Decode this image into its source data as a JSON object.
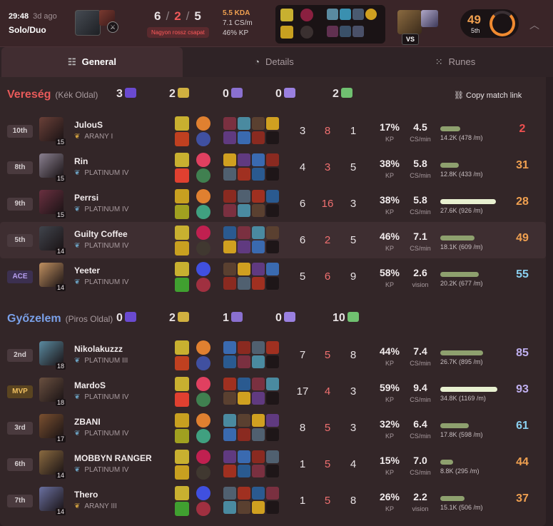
{
  "header": {
    "time": "29:48",
    "ago": "3d ago",
    "queue": "Solo/Duo",
    "kills": "6",
    "deaths": "2",
    "assists": "5",
    "badge": "Nagyon rossz csapat",
    "kda": "5.5 KDA",
    "cs": "7.1 CS/m",
    "kp": "46% KP",
    "vs": "VS",
    "score": "49",
    "place": "5th"
  },
  "tabs": [
    "General",
    "Details",
    "Runes"
  ],
  "copy_link": "Copy match link",
  "teams": [
    {
      "result": "Vereség",
      "side": "(Kék Oldal)",
      "color": "#e85a5a",
      "objectives": [
        "3",
        "2",
        "0",
        "0",
        "2"
      ],
      "players": [
        {
          "rank": "10th",
          "name": "JulouS",
          "tier": "ARANY I",
          "level": "15",
          "k": "3",
          "d": "8",
          "a": "1",
          "kp": "17%",
          "cs": "4.5",
          "cs_label": "CS/min",
          "dmg": "14.2K (478 /m)",
          "dmg_frac": 0.35,
          "score": "2",
          "score_color": "#f05050"
        },
        {
          "rank": "8th",
          "name": "Rin",
          "tier": "PLATINUM IV",
          "level": "15",
          "k": "4",
          "d": "3",
          "a": "5",
          "kp": "38%",
          "cs": "5.8",
          "cs_label": "CS/min",
          "dmg": "12.8K (433 /m)",
          "dmg_frac": 0.32,
          "score": "31",
          "score_color": "#f0a050"
        },
        {
          "rank": "9th",
          "name": "Perrsi",
          "tier": "PLATINUM IV",
          "level": "15",
          "k": "6",
          "d": "16",
          "a": "3",
          "kp": "38%",
          "cs": "5.8",
          "cs_label": "CS/min",
          "dmg": "27.6K (926 /m)",
          "dmg_frac": 0.98,
          "score": "28",
          "score_color": "#f0a050"
        },
        {
          "rank": "5th",
          "name": "Guilty Coffee",
          "tier": "PLATINUM IV",
          "level": "14",
          "k": "6",
          "d": "2",
          "a": "5",
          "kp": "46%",
          "cs": "7.1",
          "cs_label": "CS/min",
          "dmg": "18.1K (609 /m)",
          "dmg_frac": 0.6,
          "score": "49",
          "score_color": "#f0a050"
        },
        {
          "rank": "ACE",
          "name": "Yeeter",
          "tier": "PLATINUM IV",
          "level": "14",
          "k": "5",
          "d": "6",
          "a": "9",
          "kp": "58%",
          "cs": "2.6",
          "cs_label": "vision",
          "dmg": "20.2K (677 /m)",
          "dmg_frac": 0.68,
          "score": "55",
          "score_color": "#8ad0f0"
        }
      ]
    },
    {
      "result": "Győzelem",
      "side": "(Piros Oldal)",
      "color": "#7aa0e8",
      "objectives": [
        "0",
        "2",
        "1",
        "0",
        "10"
      ],
      "players": [
        {
          "rank": "2nd",
          "name": "Nikolakuzzz",
          "tier": "PLATINUM III",
          "level": "18",
          "k": "7",
          "d": "5",
          "a": "8",
          "kp": "44%",
          "cs": "7.4",
          "cs_label": "CS/min",
          "dmg": "26.7K (895 /m)",
          "dmg_frac": 0.75,
          "score": "85",
          "score_color": "#c0b0f0"
        },
        {
          "rank": "MVP",
          "name": "MardoS",
          "tier": "PLATINUM IV",
          "level": "18",
          "k": "17",
          "d": "4",
          "a": "3",
          "kp": "59%",
          "cs": "9.4",
          "cs_label": "CS/min",
          "dmg": "34.8K (1169 /m)",
          "dmg_frac": 1.0,
          "score": "93",
          "score_color": "#c0b0f0"
        },
        {
          "rank": "3rd",
          "name": "ZBANI",
          "tier": "PLATINUM IV",
          "level": "17",
          "k": "8",
          "d": "5",
          "a": "3",
          "kp": "32%",
          "cs": "6.4",
          "cs_label": "CS/min",
          "dmg": "17.8K (598 /m)",
          "dmg_frac": 0.5,
          "score": "61",
          "score_color": "#8ad0f0"
        },
        {
          "rank": "6th",
          "name": "MOBBYN RANGER",
          "tier": "PLATINUM IV",
          "level": "14",
          "k": "1",
          "d": "5",
          "a": "4",
          "kp": "15%",
          "cs": "7.0",
          "cs_label": "CS/min",
          "dmg": "8.8K (295 /m)",
          "dmg_frac": 0.22,
          "score": "44",
          "score_color": "#f0a050"
        },
        {
          "rank": "7th",
          "name": "Thero",
          "tier": "ARANY III",
          "level": "14",
          "k": "1",
          "d": "5",
          "a": "8",
          "kp": "26%",
          "cs": "2.2",
          "cs_label": "vision",
          "dmg": "15.1K (506 /m)",
          "dmg_frac": 0.42,
          "score": "37",
          "score_color": "#f0a050"
        }
      ]
    }
  ]
}
